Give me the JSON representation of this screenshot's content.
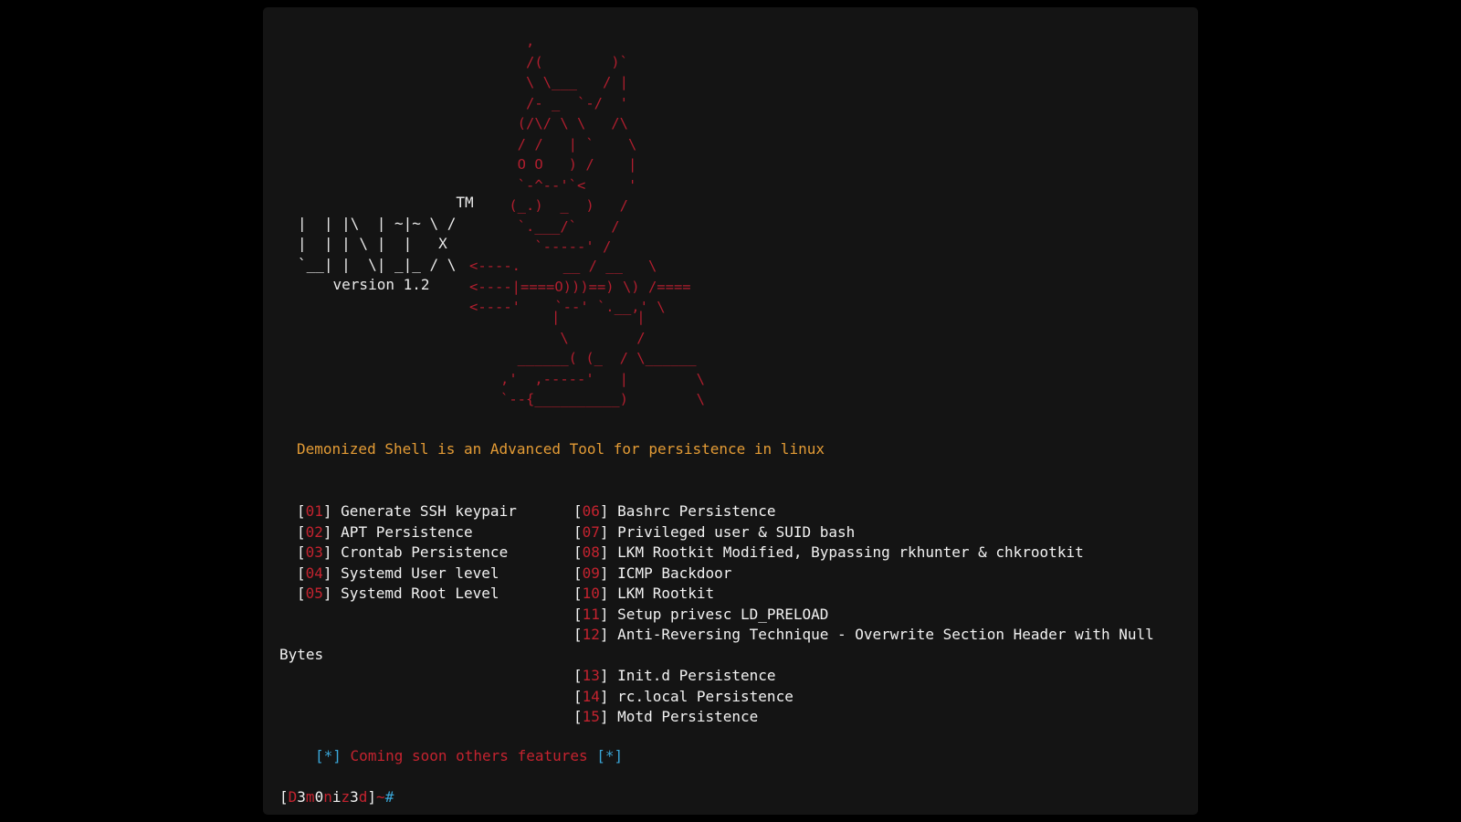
{
  "ascii_art": [
    "      ,",
    "      /(        )`",
    "      \\ \\___   / |",
    "      /- _  `-/  '",
    "     (/\\/ \\ \\   /\\",
    "     / /   | `    \\",
    "     O O   ) /    |",
    "     `-^--'`<     '",
    "    (_.)  _  )   /",
    "     `.___/`    /",
    "       `-----' /"
  ],
  "ascii_art_lower": [
    "         |         |",
    "          \\        /",
    "     ______( (_  / \\______",
    "   ,'  ,-----'   |        \\",
    "   `--{__________)        \\"
  ],
  "logo": {
    "tm": "                  TM",
    "lines": [
      "|  | |\\  | ~|~ \\ /",
      "|  | | \\ |  |   X",
      "`__| |  \\| _|_ / \\"
    ],
    "version": "    version 1.2"
  },
  "arrows": [
    "<----.     __ / __   \\",
    "<----|====O)))==) \\) /====",
    "<----'    `--' `.__,' \\"
  ],
  "description": "Demonized Shell is an Advanced Tool for persistence in linux",
  "menu_left": [
    {
      "num": "01",
      "label": "Generate SSH keypair"
    },
    {
      "num": "02",
      "label": "APT Persistence"
    },
    {
      "num": "03",
      "label": "Crontab Persistence"
    },
    {
      "num": "04",
      "label": "Systemd User level"
    },
    {
      "num": "05",
      "label": "Systemd Root Level"
    }
  ],
  "menu_right": [
    {
      "num": "06",
      "label": "Bashrc Persistence"
    },
    {
      "num": "07",
      "label": "Privileged user & SUID bash"
    },
    {
      "num": "08",
      "label": "LKM Rootkit Modified, Bypassing rkhunter & chkrootkit"
    },
    {
      "num": "09",
      "label": "ICMP Backdoor"
    },
    {
      "num": "10",
      "label": "LKM Rootkit"
    },
    {
      "num": "11",
      "label": "Setup privesc LD_PRELOAD"
    },
    {
      "num": "12",
      "label": "Anti-Reversing Technique - Overwrite Section Header with Null"
    }
  ],
  "wrap_text": "Bytes",
  "menu_right2": [
    {
      "num": "13",
      "label": "Init.d Persistence"
    },
    {
      "num": "14",
      "label": "rc.local Persistence"
    },
    {
      "num": "15",
      "label": "Motd Persistence"
    }
  ],
  "coming_soon": {
    "marker": "[*]",
    "text": "Coming soon others features"
  },
  "prompt": {
    "open": "[",
    "chars": [
      "D",
      "3",
      "m",
      "0",
      "n",
      "i",
      "z",
      "3",
      "d"
    ],
    "close": "]",
    "tail": "~",
    "hash": "#"
  },
  "colors": {
    "background": "#141414",
    "red": "#c4232f",
    "orange": "#e39b35",
    "blue": "#3aa6d8",
    "text": "#f2f2f2"
  }
}
